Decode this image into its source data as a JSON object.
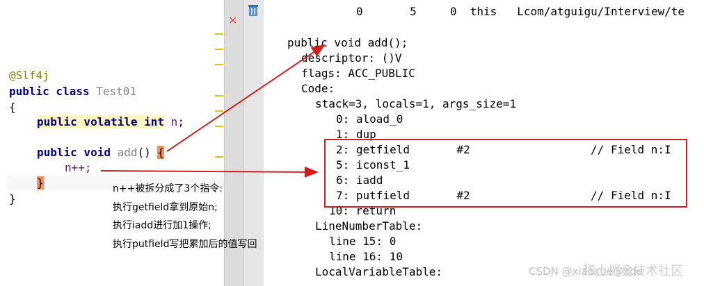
{
  "editor": {
    "annotation": "@Slf4j",
    "class_kw": "public class",
    "class_name": "Test01",
    "open_brace": "{",
    "field_line_kw": "public volatile int",
    "field_name": "n",
    "field_semicolon": ";",
    "method_kw": "public void",
    "method_name": "add",
    "method_parens": "() ",
    "method_brace": "{",
    "stmt": "n++;",
    "close_inner": "}",
    "close_outer": "}"
  },
  "bytecode": {
    "top_row": "0       5     0  this   Lcom/atguigu/Interview/te",
    "method_sig": "public void add();",
    "descriptor": "descriptor: ()V",
    "flags": "flags: ACC_PUBLIC",
    "code": "Code:",
    "stack": "stack=3, locals=1, args_size=1",
    "i0": "0: aload_0",
    "i1": "1: dup",
    "i2": "2: getfield       #2                  // Field n:I",
    "i5": "5: iconst_1",
    "i6": "6: iadd",
    "i7": "7: putfield       #2                  // Field n:I",
    "i10": "10: return",
    "lnt": "LineNumberTable:",
    "line15": "line 15: 0",
    "line16": "line 16: 10",
    "lvt": "LocalVariableTable:"
  },
  "note": {
    "line1": "n++被拆分成了3个指令:",
    "line2": "执行getfield拿到原始n;",
    "line3": "执行iadd进行加1操作;",
    "line4": "执行putfield写把累加后的值写回"
  },
  "watermark": {
    "csdn": "CSDN @xiaoxue@xde",
    "juejin": "稀土掘金技术社区"
  },
  "colors": {
    "arrow": "#d11f1f",
    "box": "#d11f1f"
  }
}
